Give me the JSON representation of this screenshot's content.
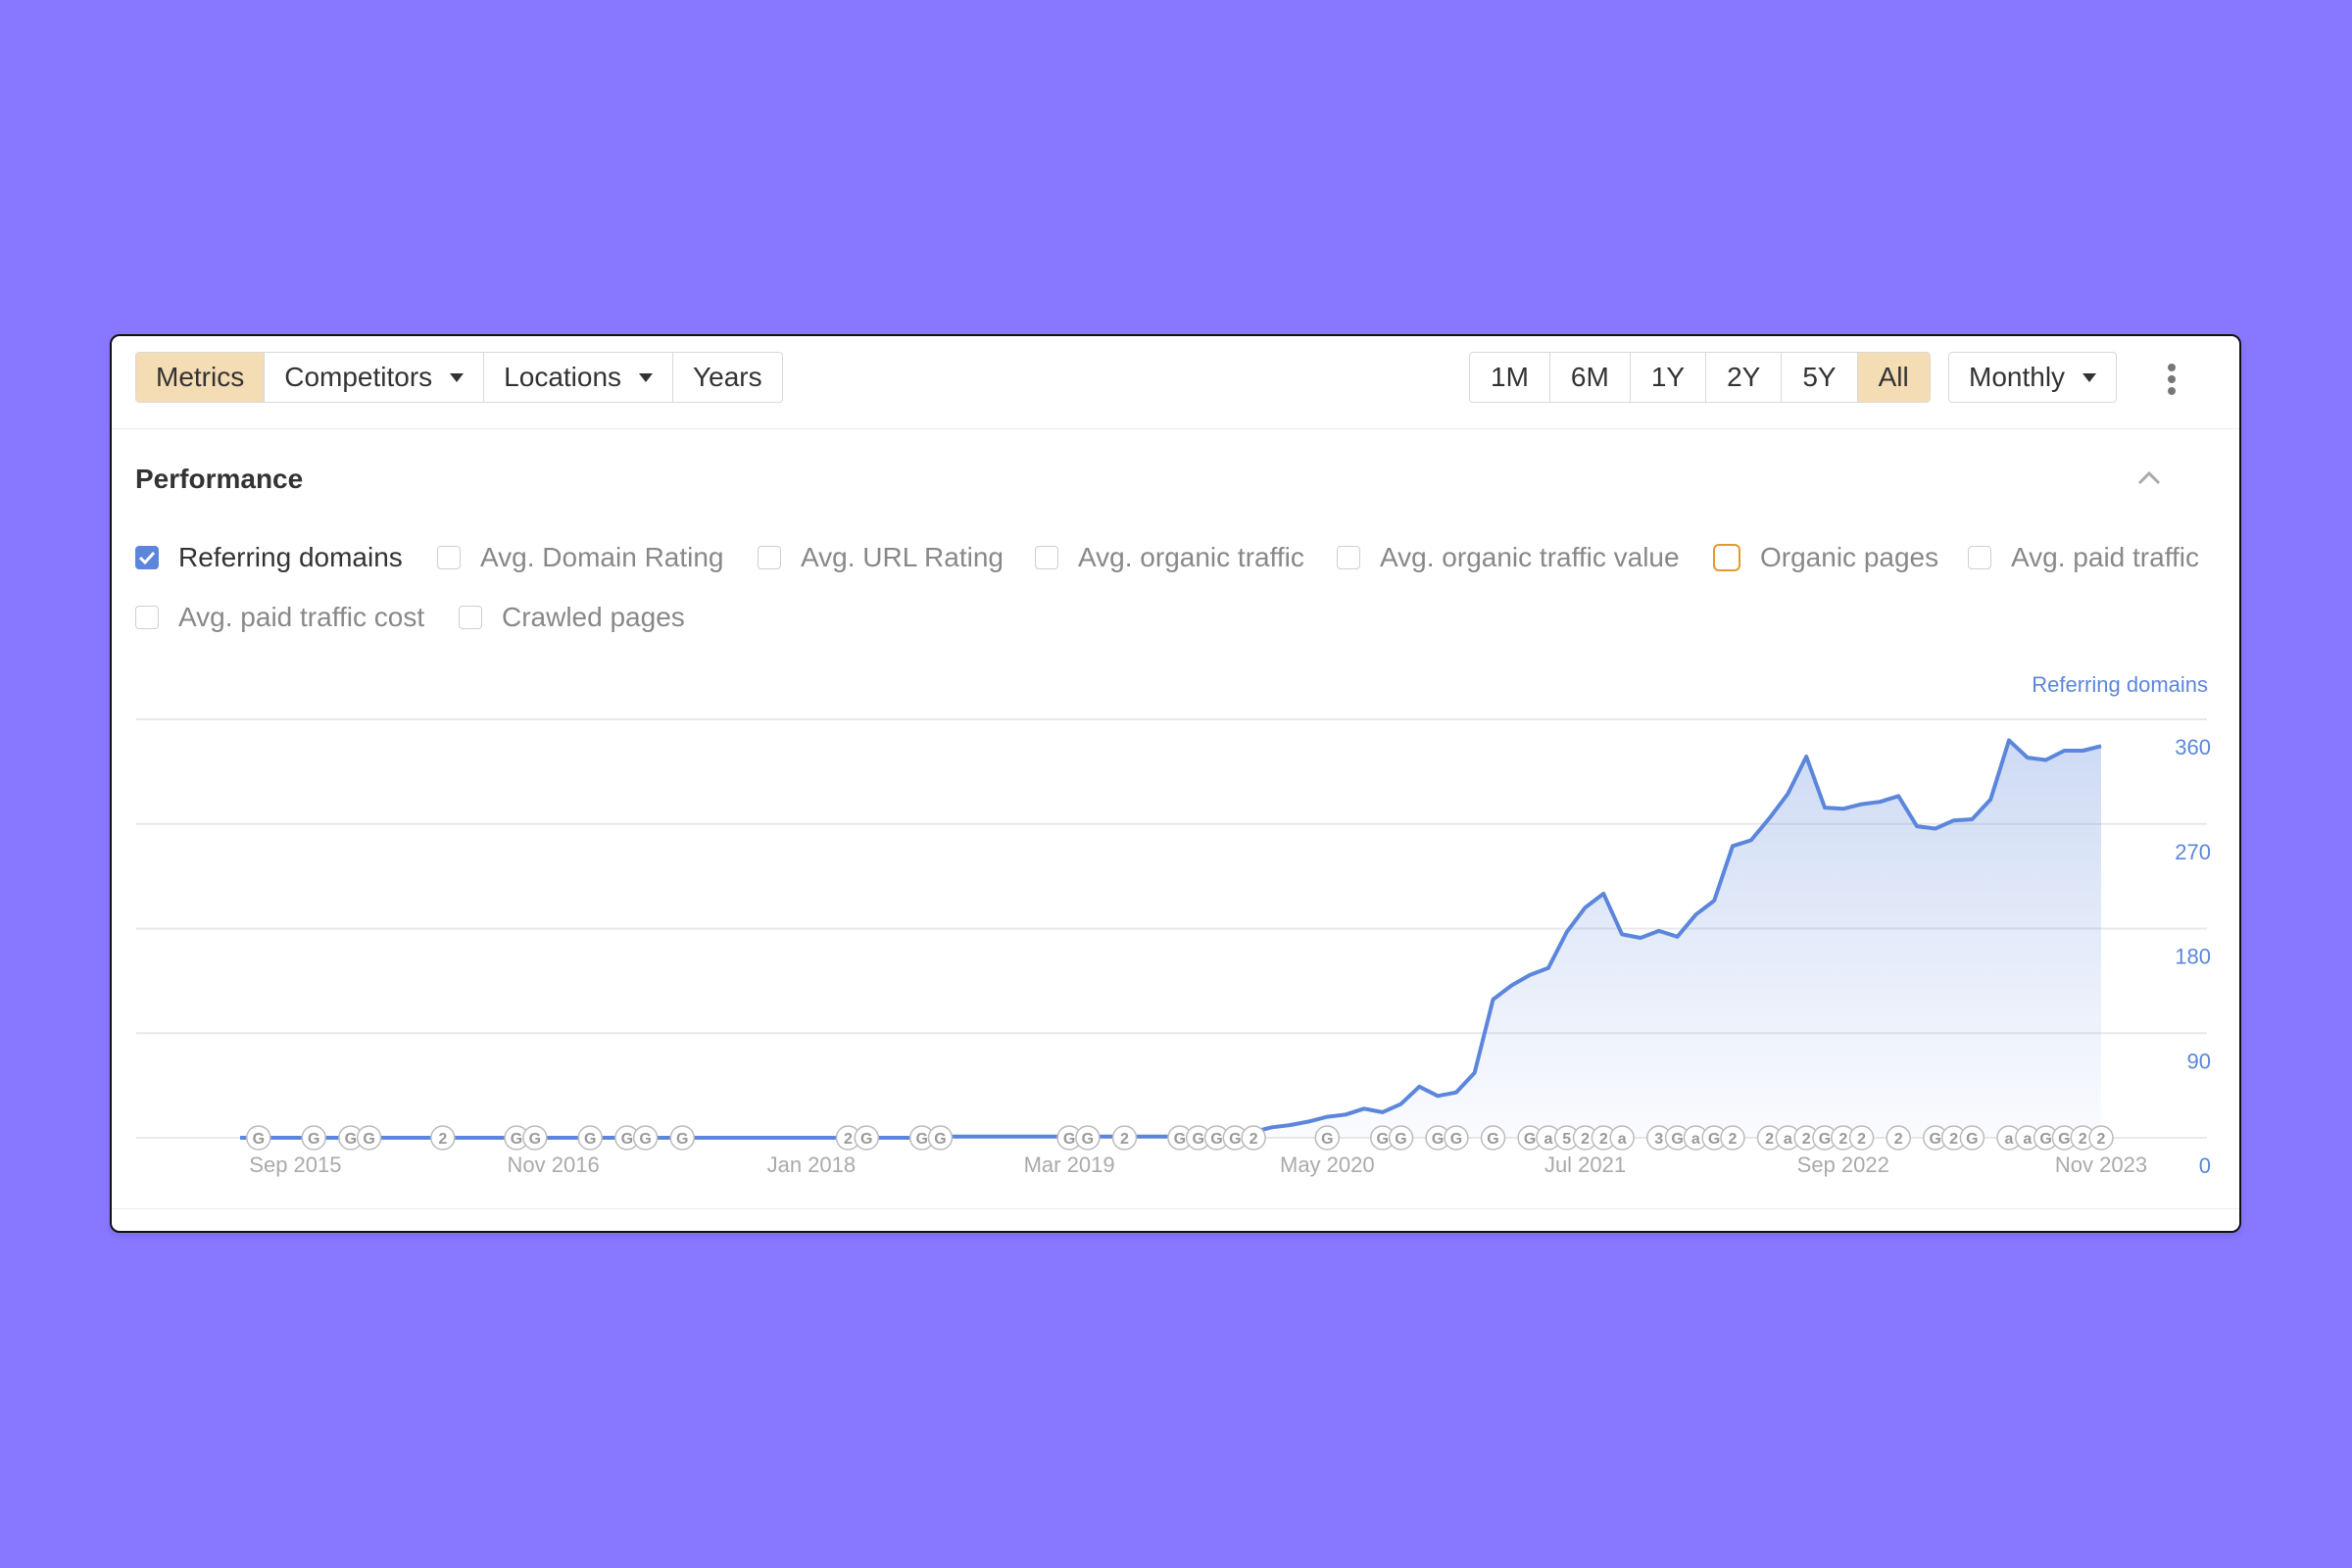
{
  "toolbar": {
    "left_tabs": [
      {
        "label": "Metrics",
        "active": true,
        "dropdown": false
      },
      {
        "label": "Competitors",
        "active": false,
        "dropdown": true
      },
      {
        "label": "Locations",
        "active": false,
        "dropdown": true
      },
      {
        "label": "Years",
        "active": false,
        "dropdown": false
      }
    ],
    "ranges": [
      {
        "label": "1M",
        "active": false
      },
      {
        "label": "6M",
        "active": false
      },
      {
        "label": "1Y",
        "active": false
      },
      {
        "label": "2Y",
        "active": false
      },
      {
        "label": "5Y",
        "active": false
      },
      {
        "label": "All",
        "active": true
      }
    ],
    "interval": "Monthly",
    "more_icon": "vertical-ellipsis-icon"
  },
  "section": {
    "title": "Performance",
    "collapse_icon": "chevron-up-icon"
  },
  "metrics": [
    {
      "label": "Referring domains",
      "checked": true,
      "highlight": null
    },
    {
      "label": "Avg. Domain Rating",
      "checked": false,
      "highlight": null
    },
    {
      "label": "Avg. URL Rating",
      "checked": false,
      "highlight": null
    },
    {
      "label": "Avg. organic traffic",
      "checked": false,
      "highlight": null
    },
    {
      "label": "Avg. organic traffic value",
      "checked": false,
      "highlight": null
    },
    {
      "label": "Organic pages",
      "checked": false,
      "highlight": "#e39a2d"
    },
    {
      "label": "Avg. paid traffic",
      "checked": false,
      "highlight": null
    },
    {
      "label": "Avg. paid traffic cost",
      "checked": false,
      "highlight": null
    },
    {
      "label": "Crawled pages",
      "checked": false,
      "highlight": null
    }
  ],
  "colors": {
    "background": "#8877ff",
    "active_tab": "#f4dcb4",
    "series": "#5b86dc",
    "highlight": "#e39a2d"
  },
  "chart_data": {
    "type": "area",
    "title": "",
    "series_label": "Referring domains",
    "xlabel": "",
    "ylabel": "Referring domains",
    "ylim": [
      0,
      360
    ],
    "y_ticks": [
      360,
      270,
      180,
      90,
      0
    ],
    "y_axis_position": "right",
    "grid": true,
    "start_month": "Jun 2015",
    "end_month": "Nov 2023",
    "x_tick_labels": [
      {
        "label": "Sep 2015",
        "month_index": 3
      },
      {
        "label": "Nov 2016",
        "month_index": 17
      },
      {
        "label": "Jan 2018",
        "month_index": 31
      },
      {
        "label": "Mar 2019",
        "month_index": 45
      },
      {
        "label": "May 2020",
        "month_index": 59
      },
      {
        "label": "Jul 2021",
        "month_index": 73
      },
      {
        "label": "Sep 2022",
        "month_index": 87
      },
      {
        "label": "Nov 2023",
        "month_index": 101
      }
    ],
    "series": [
      {
        "name": "Referring domains",
        "values": [
          0,
          0,
          0,
          0,
          0,
          0,
          0,
          0,
          0,
          0,
          0,
          0,
          0,
          0,
          0,
          0,
          0,
          0,
          0,
          0,
          0,
          0,
          0,
          0,
          0,
          0,
          0,
          0,
          0,
          0,
          0,
          0,
          0,
          0,
          0,
          0,
          0,
          0,
          1,
          1,
          1,
          1,
          1,
          1,
          1,
          1,
          1,
          1,
          1,
          1,
          1,
          1,
          1,
          1,
          2,
          5,
          9,
          11,
          14,
          18,
          20,
          25,
          22,
          29,
          44,
          36,
          39,
          56,
          119,
          131,
          140,
          146,
          177,
          198,
          210,
          175,
          172,
          178,
          173,
          192,
          204,
          251,
          256,
          275,
          296,
          328,
          284,
          283,
          287,
          289,
          294,
          268,
          266,
          273,
          274,
          291,
          342,
          327,
          325,
          333,
          333,
          337
        ]
      }
    ],
    "annotations": [
      {
        "month_index": 1,
        "label": "G"
      },
      {
        "month_index": 4,
        "label": "G"
      },
      {
        "month_index": 6,
        "label": "G"
      },
      {
        "month_index": 7,
        "label": "G"
      },
      {
        "month_index": 11,
        "label": "2"
      },
      {
        "month_index": 15,
        "label": "G"
      },
      {
        "month_index": 16,
        "label": "G"
      },
      {
        "month_index": 19,
        "label": "G"
      },
      {
        "month_index": 21,
        "label": "G"
      },
      {
        "month_index": 22,
        "label": "G"
      },
      {
        "month_index": 24,
        "label": "G"
      },
      {
        "month_index": 33,
        "label": "2"
      },
      {
        "month_index": 34,
        "label": "G"
      },
      {
        "month_index": 37,
        "label": "G"
      },
      {
        "month_index": 38,
        "label": "G"
      },
      {
        "month_index": 45,
        "label": "G"
      },
      {
        "month_index": 46,
        "label": "G"
      },
      {
        "month_index": 48,
        "label": "2"
      },
      {
        "month_index": 51,
        "label": "G"
      },
      {
        "month_index": 52,
        "label": "G"
      },
      {
        "month_index": 53,
        "label": "G"
      },
      {
        "month_index": 54,
        "label": "G"
      },
      {
        "month_index": 55,
        "label": "2"
      },
      {
        "month_index": 59,
        "label": "G"
      },
      {
        "month_index": 62,
        "label": "G"
      },
      {
        "month_index": 63,
        "label": "G"
      },
      {
        "month_index": 65,
        "label": "G"
      },
      {
        "month_index": 66,
        "label": "G"
      },
      {
        "month_index": 68,
        "label": "G"
      },
      {
        "month_index": 70,
        "label": "G"
      },
      {
        "month_index": 71,
        "label": "a"
      },
      {
        "month_index": 72,
        "label": "5"
      },
      {
        "month_index": 73,
        "label": "2"
      },
      {
        "month_index": 74,
        "label": "2"
      },
      {
        "month_index": 75,
        "label": "a"
      },
      {
        "month_index": 77,
        "label": "3"
      },
      {
        "month_index": 78,
        "label": "G"
      },
      {
        "month_index": 79,
        "label": "a"
      },
      {
        "month_index": 80,
        "label": "G"
      },
      {
        "month_index": 81,
        "label": "2"
      },
      {
        "month_index": 83,
        "label": "2"
      },
      {
        "month_index": 84,
        "label": "a"
      },
      {
        "month_index": 85,
        "label": "2"
      },
      {
        "month_index": 86,
        "label": "G"
      },
      {
        "month_index": 87,
        "label": "2"
      },
      {
        "month_index": 88,
        "label": "2"
      },
      {
        "month_index": 90,
        "label": "2"
      },
      {
        "month_index": 92,
        "label": "G"
      },
      {
        "month_index": 93,
        "label": "2"
      },
      {
        "month_index": 94,
        "label": "G"
      },
      {
        "month_index": 96,
        "label": "a"
      },
      {
        "month_index": 97,
        "label": "a"
      },
      {
        "month_index": 98,
        "label": "G"
      },
      {
        "month_index": 99,
        "label": "G"
      },
      {
        "month_index": 100,
        "label": "2"
      },
      {
        "month_index": 101,
        "label": "2"
      }
    ]
  }
}
